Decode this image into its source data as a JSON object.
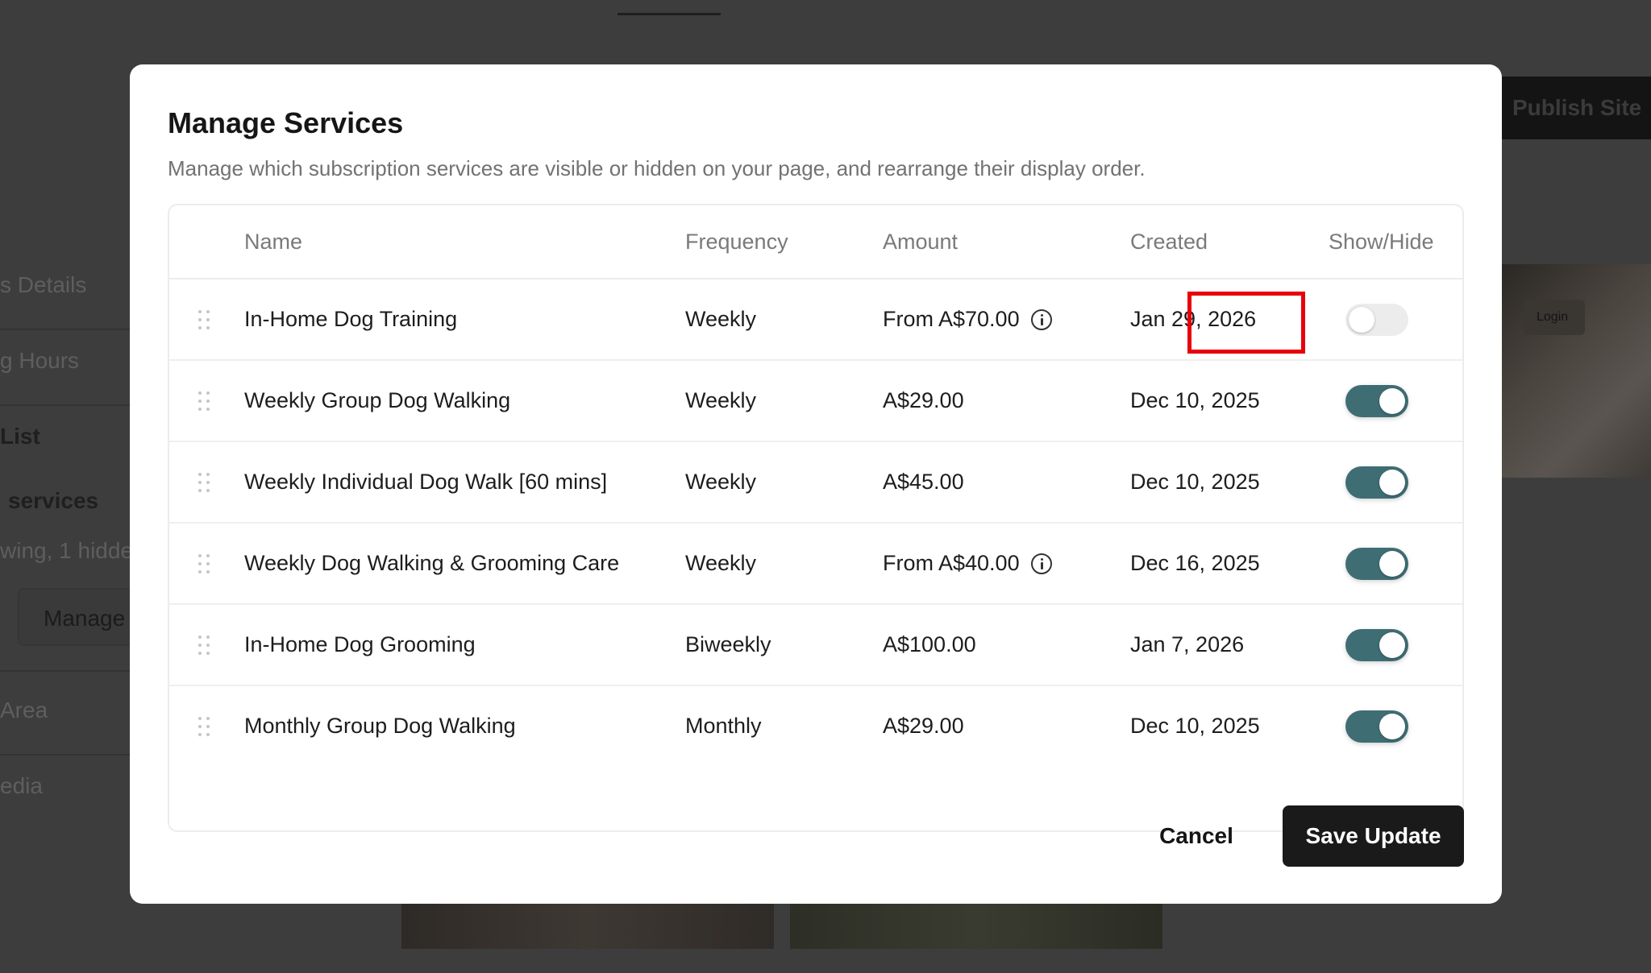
{
  "background": {
    "sidebar": [
      {
        "text": "s Details"
      },
      {
        "text": "g Hours"
      },
      {
        "text": "List"
      },
      {
        "text": "services"
      },
      {
        "text": "wing, 1 hidde"
      },
      {
        "text": "Area"
      },
      {
        "text": "edia"
      }
    ],
    "manage_label": "Manage",
    "publish_label": "Publish Site",
    "login_label": "Login"
  },
  "modal": {
    "title": "Manage Services",
    "description": "Manage which subscription services are visible or hidden on your page, and rearrange their display order.",
    "columns": {
      "name": "Name",
      "frequency": "Frequency",
      "amount": "Amount",
      "created": "Created",
      "showhide": "Show/Hide"
    },
    "rows": [
      {
        "name": "In-Home Dog Training",
        "frequency": "Weekly",
        "amount": "From A$70.00",
        "has_info": true,
        "created": "Jan 29, 2026",
        "visible": false
      },
      {
        "name": "Weekly Group Dog Walking",
        "frequency": "Weekly",
        "amount": "A$29.00",
        "has_info": false,
        "created": "Dec 10, 2025",
        "visible": true
      },
      {
        "name": "Weekly Individual Dog Walk [60 mins]",
        "frequency": "Weekly",
        "amount": "A$45.00",
        "has_info": false,
        "created": "Dec 10, 2025",
        "visible": true
      },
      {
        "name": "Weekly Dog Walking & Grooming Care",
        "frequency": "Weekly",
        "amount": "From A$40.00",
        "has_info": true,
        "created": "Dec 16, 2025",
        "visible": true
      },
      {
        "name": "In-Home Dog Grooming",
        "frequency": "Biweekly",
        "amount": "A$100.00",
        "has_info": false,
        "created": "Jan 7, 2026",
        "visible": true
      },
      {
        "name": "Monthly Group Dog Walking",
        "frequency": "Monthly",
        "amount": "A$29.00",
        "has_info": false,
        "created": "Dec 10, 2025",
        "visible": true
      }
    ],
    "cancel_label": "Cancel",
    "save_label": "Save Update"
  },
  "colors": {
    "toggle_on": "#3f6d74",
    "toggle_off": "#ececec",
    "highlight": "#e8000b",
    "primary_button": "#1a1a1a"
  }
}
